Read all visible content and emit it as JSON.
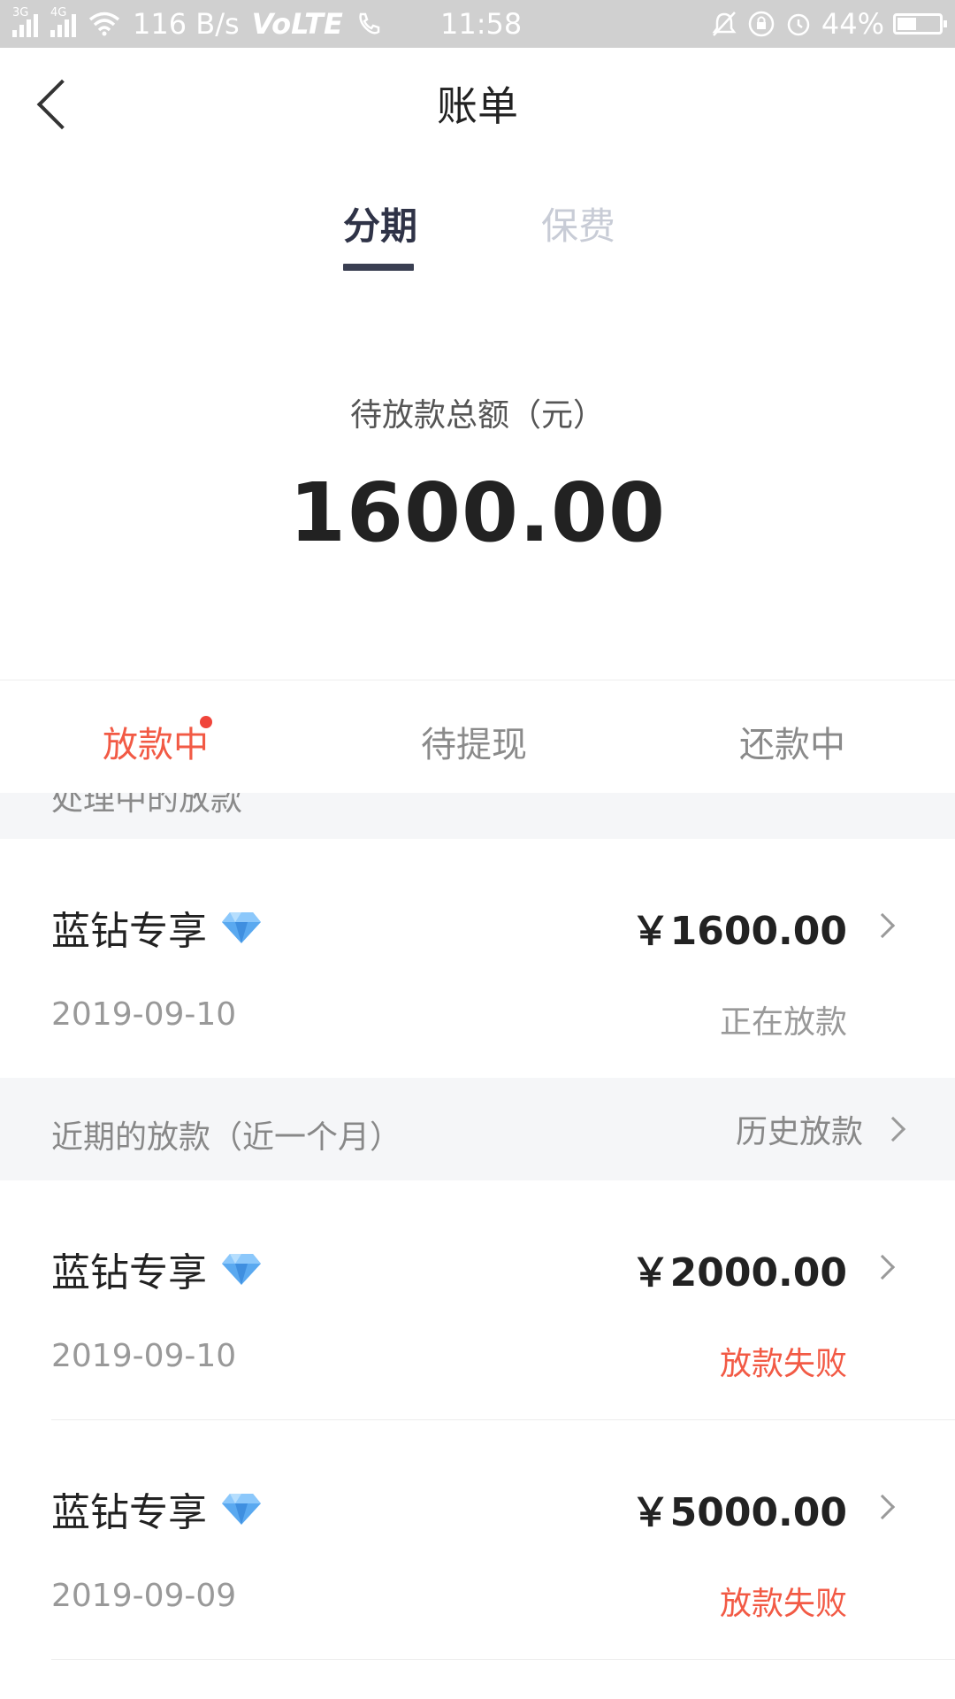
{
  "status_bar": {
    "net_3g": "3G",
    "net_4g": "4G",
    "speed": "116 B/s",
    "volte": "VoLTE",
    "time": "11:58",
    "battery": "44%",
    "battery_level": 0.44
  },
  "header": {
    "title": "账单",
    "back_icon": "chevron-left-icon"
  },
  "top_tabs": [
    {
      "label": "分期",
      "active": true
    },
    {
      "label": "保费",
      "active": false
    }
  ],
  "summary": {
    "label": "待放款总额（元）",
    "amount": "1600.00"
  },
  "sub_tabs": [
    {
      "label": "放款中",
      "active": true,
      "badge": true
    },
    {
      "label": "待提现",
      "active": false
    },
    {
      "label": "还款中",
      "active": false
    }
  ],
  "processing_section": {
    "label": "处理中的放款"
  },
  "processing_items": [
    {
      "name": "蓝钻专享",
      "amount": "￥1600.00",
      "date": "2019-09-10",
      "status": "正在放款",
      "status_type": "ok",
      "icon": "diamond-icon"
    }
  ],
  "recent_section": {
    "label": "近期的放款（近一个月）",
    "link": "历史放款"
  },
  "recent_items": [
    {
      "name": "蓝钻专享",
      "amount": "￥2000.00",
      "date": "2019-09-10",
      "status": "放款失败",
      "status_type": "fail",
      "icon": "diamond-icon"
    },
    {
      "name": "蓝钻专享",
      "amount": "￥5000.00",
      "date": "2019-09-09",
      "status": "放款失败",
      "status_type": "fail",
      "icon": "diamond-icon"
    }
  ],
  "colors": {
    "accent_red": "#f25a45",
    "tab_dark": "#2f3347",
    "band_bg": "#f5f6f8"
  }
}
